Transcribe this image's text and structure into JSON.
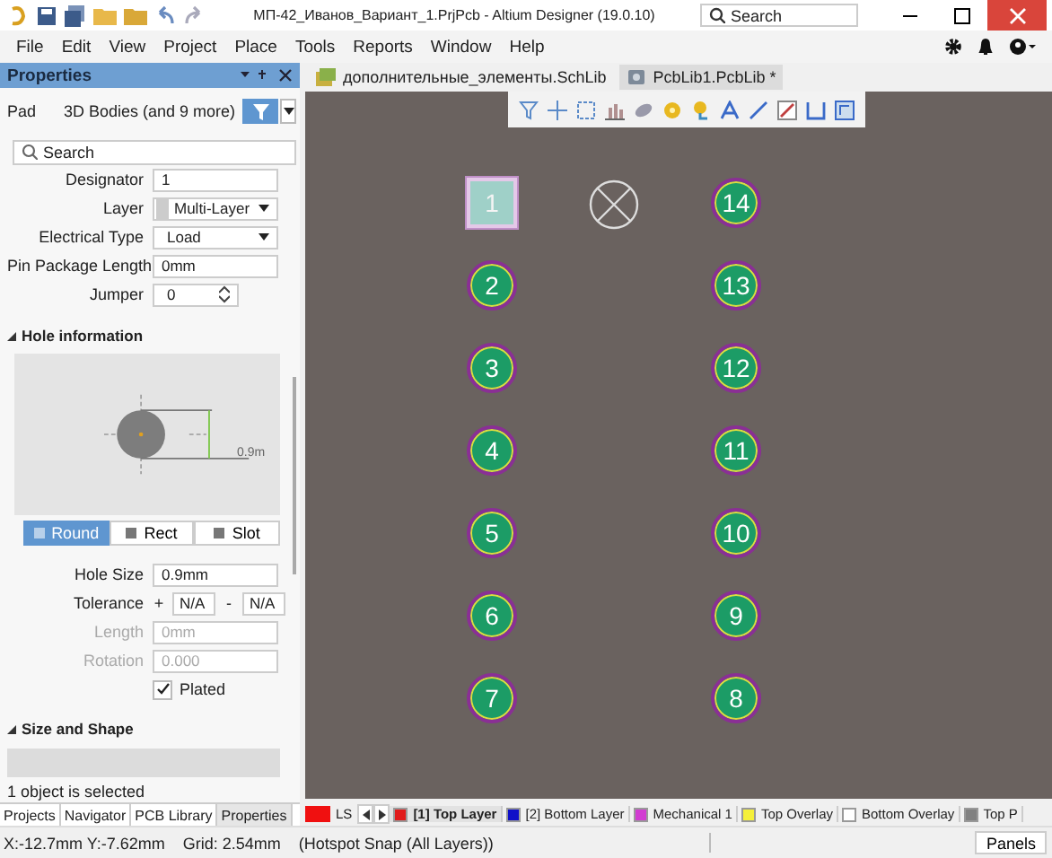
{
  "title_bar": {
    "title": "МП-42_Иванов_Вариант_1.PrjPcb - Altium Designer (19.0.10)",
    "search": {
      "placeholder": "Search"
    }
  },
  "menu": [
    "File",
    "Edit",
    "View",
    "Project",
    "Place",
    "Tools",
    "Reports",
    "Window",
    "Help"
  ],
  "properties": {
    "title": "Properties",
    "object": "Pad",
    "filter": "3D Bodies (and 9 more)",
    "search": {
      "placeholder": "Search"
    },
    "fields": [
      {
        "label": "Designator",
        "value": "1",
        "kind": "text"
      },
      {
        "label": "Layer",
        "value": "Multi-Layer",
        "kind": "layer"
      },
      {
        "label": "Electrical Type",
        "value": "Load",
        "kind": "dropdown"
      },
      {
        "label": "Pin Package Length",
        "value": "0mm",
        "kind": "text"
      },
      {
        "label": "Jumper",
        "value": "0",
        "kind": "spinner"
      }
    ],
    "hole_section": {
      "title": "Hole information",
      "expanded": true,
      "dimension": "0.9m",
      "shapes": [
        {
          "label": "Round",
          "selected": true
        },
        {
          "label": "Rect",
          "selected": false
        },
        {
          "label": "Slot",
          "selected": false
        }
      ],
      "fields": [
        {
          "label": "Hole Size",
          "value": "0.9mm",
          "kind": "text",
          "disabled": false
        },
        {
          "label": "Tolerance",
          "plus": "+",
          "value": "N/A",
          "minus": "-",
          "value2": "N/A",
          "kind": "tolerance",
          "disabled": false
        },
        {
          "label": "Length",
          "value": "0mm",
          "kind": "text",
          "disabled": true
        },
        {
          "label": "Rotation",
          "value": "0.000",
          "kind": "text",
          "disabled": true
        }
      ],
      "plated": {
        "label": "Plated",
        "checked": true
      }
    },
    "size_section": {
      "title": "Size and Shape",
      "expanded": true
    },
    "status": "1 object is selected",
    "panel_tabs": [
      {
        "label": "Projects",
        "selected": false
      },
      {
        "label": "Navigator",
        "selected": false
      },
      {
        "label": "PCB Library",
        "selected": false
      },
      {
        "label": "Properties",
        "selected": true
      }
    ]
  },
  "document_tabs": [
    {
      "label": "дополнительные_элементы.SchLib",
      "selected": false
    },
    {
      "label": "PcbLib1.PcbLib *",
      "selected": true
    }
  ],
  "pads": {
    "left_column": [
      {
        "designator": "1",
        "selected": true
      },
      {
        "designator": "2",
        "selected": false
      },
      {
        "designator": "3",
        "selected": false
      },
      {
        "designator": "4",
        "selected": false
      },
      {
        "designator": "5",
        "selected": false
      },
      {
        "designator": "6",
        "selected": false
      },
      {
        "designator": "7",
        "selected": false
      }
    ],
    "right_column": [
      {
        "designator": "14",
        "selected": false
      },
      {
        "designator": "13",
        "selected": false
      },
      {
        "designator": "12",
        "selected": false
      },
      {
        "designator": "11",
        "selected": false
      },
      {
        "designator": "10",
        "selected": false
      },
      {
        "designator": "9",
        "selected": false
      },
      {
        "designator": "8",
        "selected": false
      }
    ]
  },
  "layer_tabs": {
    "current": "LS",
    "layers": [
      {
        "label": "[1] Top Layer",
        "color": "#e01b1b",
        "selected": true
      },
      {
        "label": "[2] Bottom Layer",
        "color": "#1010c8",
        "selected": false
      },
      {
        "label": "Mechanical 1",
        "color": "#d23cd2",
        "selected": false
      },
      {
        "label": "Top Overlay",
        "color": "#f5f03a",
        "selected": false
      },
      {
        "label": "Bottom Overlay",
        "color": "#ffffff",
        "selected": false
      },
      {
        "label": "Top P",
        "color": "#808080",
        "selected": false
      }
    ]
  },
  "status_bar": {
    "coordinates": "X:-12.7mm Y:-7.62mm",
    "grid": "Grid: 2.54mm",
    "snap": "(Hotspot Snap (All Layers))",
    "panels_button": "Panels"
  }
}
